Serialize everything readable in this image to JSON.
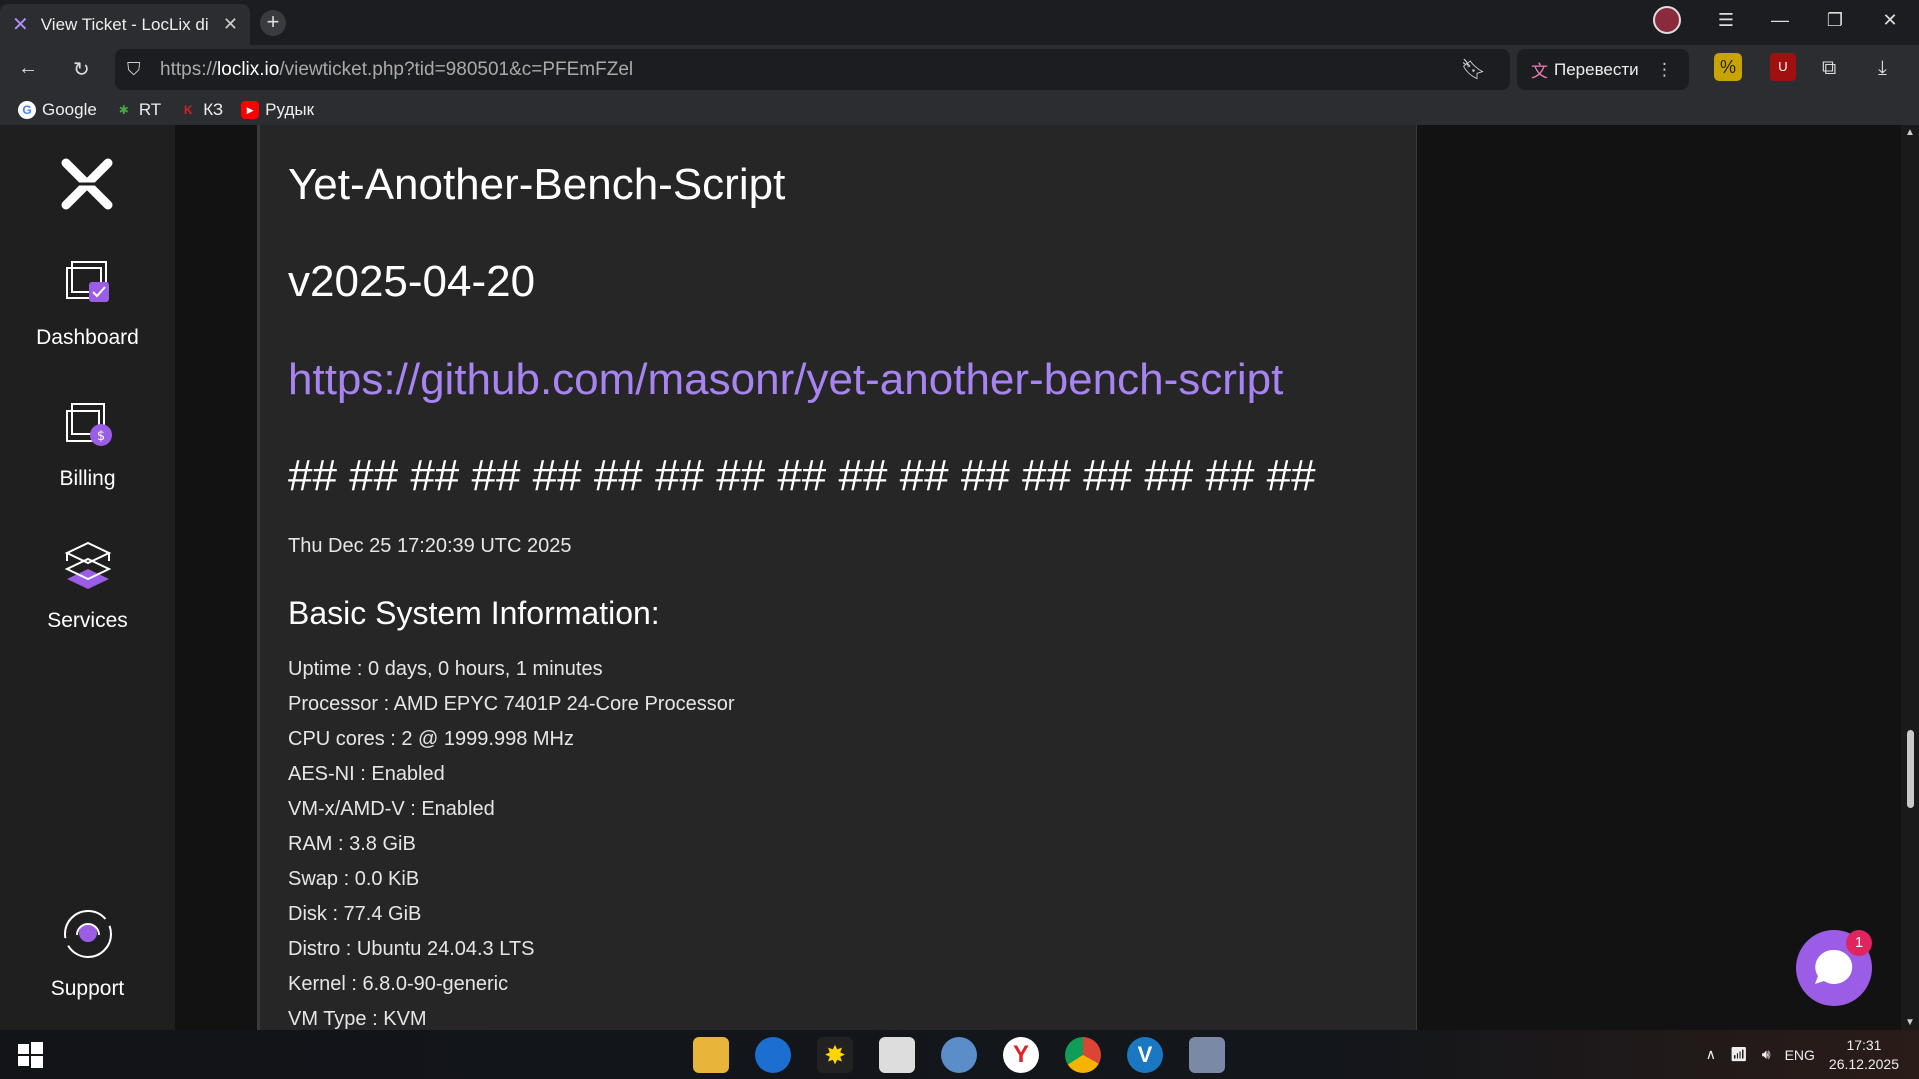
{
  "browser": {
    "tab_title": "View Ticket - LocLix di S",
    "new_tab": "+",
    "url_prefix": "https://",
    "url_host": "loclix.io",
    "url_path": "/viewticket.php?tid=980501&c=PFEmFZel",
    "translate_label": "Перевести",
    "bookmarks": [
      {
        "label": "Google",
        "icon": "google-icon",
        "color": "#4285f4"
      },
      {
        "label": "RT",
        "icon": "rt-icon",
        "color": "#44aa44"
      },
      {
        "label": "КЗ",
        "icon": "kz-icon",
        "color": "#cc2222"
      },
      {
        "label": "Рудык",
        "icon": "youtube-icon",
        "color": "#ff0000"
      }
    ]
  },
  "sidebar": {
    "items": [
      {
        "label": "Dashboard",
        "icon": "dashboard-icon"
      },
      {
        "label": "Billing",
        "icon": "billing-icon"
      },
      {
        "label": "Services",
        "icon": "services-icon"
      },
      {
        "label": "Support",
        "icon": "support-icon"
      }
    ],
    "accent": "#9b5de5"
  },
  "content": {
    "heading_1": "Yet-Another-Bench-Script",
    "heading_2": "v2025-04-20",
    "link": "https://github.com/masonr/yet-another-bench-script",
    "hashes": "## ## ## ## ## ## ## ## ## ## ## ## ## ## ## ## ##",
    "date": "Thu Dec 25 17:20:39 UTC 2025",
    "section_title": "Basic System Information:",
    "lines": [
      "Uptime : 0 days, 0 hours, 1 minutes",
      "Processor : AMD EPYC 7401P 24-Core Processor",
      "CPU cores : 2 @ 1999.998 MHz",
      "AES-NI : Enabled",
      "VM-x/AMD-V : Enabled",
      "RAM : 3.8 GiB",
      "Swap : 0.0 KiB",
      "Disk : 77.4 GiB",
      "Distro : Ubuntu 24.04.3 LTS",
      "Kernel : 6.8.0-90-generic",
      "VM Type : KVM"
    ]
  },
  "chat": {
    "badge": "1"
  },
  "taskbar": {
    "lang": "ENG",
    "time": "17:31",
    "date": "26.12.2025"
  }
}
